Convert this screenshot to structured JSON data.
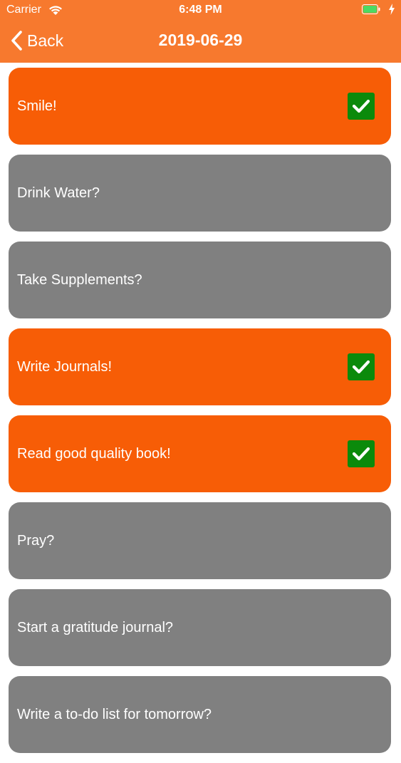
{
  "status_bar": {
    "carrier": "Carrier",
    "time": "6:48 PM",
    "icons": [
      "wifi-icon",
      "battery-icon",
      "charging-bolt-icon"
    ]
  },
  "nav": {
    "back_label": "Back",
    "title": "2019-06-29"
  },
  "colors": {
    "navbar": "#f7792e",
    "done": "#f75d06",
    "todo": "#808080",
    "check": "#0b8a0b"
  },
  "items": [
    {
      "label": "Smile!",
      "done": true
    },
    {
      "label": "Drink Water?",
      "done": false
    },
    {
      "label": "Take Supplements?",
      "done": false
    },
    {
      "label": "Write Journals!",
      "done": true
    },
    {
      "label": "Read good quality book!",
      "done": true
    },
    {
      "label": "Pray?",
      "done": false
    },
    {
      "label": "Start a gratitude journal?",
      "done": false
    },
    {
      "label": "Write a to-do list for tomorrow?",
      "done": false
    }
  ]
}
